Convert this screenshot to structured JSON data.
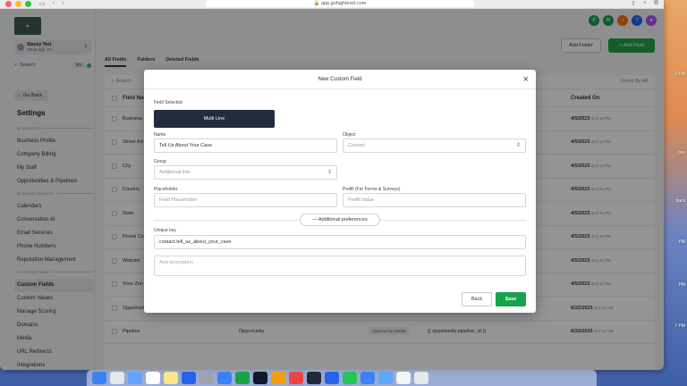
{
  "browser": {
    "url": "app.gohighlevel.com"
  },
  "sidebar": {
    "logo_text": "",
    "account_name": "Stacey Test",
    "account_location": "Pittsburgh, PA",
    "search_label": "Search",
    "search_shortcut": "⌘K",
    "go_back": "Go Back",
    "settings_title": "Settings",
    "sections": [
      {
        "title": "MY BUSINESS",
        "items": [
          "Business Profile",
          "Company Billing",
          "My Staff",
          "Opportunities & Pipelines"
        ]
      },
      {
        "title": "BUSINESS SERVICES",
        "items": [
          "Calendars",
          "Conversation AI",
          "Email Services",
          "Phone Numbers",
          "Reputation Management"
        ]
      },
      {
        "title": "OTHER SETTINGS",
        "items": [
          "Custom Fields",
          "Custom Values",
          "Manage Scoring",
          "Domains",
          "Media",
          "URL Redirects",
          "Integrations"
        ]
      }
    ],
    "active_item": "Custom Fields"
  },
  "main": {
    "tabs": [
      "All Fields",
      "Folders",
      "Deleted Fields"
    ],
    "add_folder": "Add Folder",
    "add_field": "+ Add Field",
    "search_placeholder": "Search",
    "group_by": "Group By All",
    "columns": {
      "name": "Field Name",
      "created": "Created On"
    },
    "rows": [
      {
        "name": "Business",
        "object": "",
        "folder": "",
        "key": "",
        "date": "4/5/2023",
        "time": "at 4:16 PM"
      },
      {
        "name": "Street Ad",
        "object": "",
        "folder": "",
        "key": "",
        "date": "4/5/2023",
        "time": "at 4:16 PM"
      },
      {
        "name": "City",
        "object": "",
        "folder": "",
        "key": "",
        "date": "4/5/2023",
        "time": "at 4:16 PM"
      },
      {
        "name": "Country",
        "object": "",
        "folder": "",
        "key": "",
        "date": "4/5/2023",
        "time": "at 4:16 PM"
      },
      {
        "name": "State",
        "object": "",
        "folder": "",
        "key": "",
        "date": "4/5/2023",
        "time": "at 4:16 PM"
      },
      {
        "name": "Postal Co",
        "object": "",
        "folder": "",
        "key": "",
        "date": "4/5/2023",
        "time": "at 4:16 PM"
      },
      {
        "name": "Website",
        "object": "",
        "folder": "",
        "key": "",
        "date": "4/5/2023",
        "time": "at 4:16 PM"
      },
      {
        "name": "Time Zon",
        "object": "",
        "folder": "",
        "key": "",
        "date": "4/5/2023",
        "time": "at 4:16 PM"
      },
      {
        "name": "Opportunity Name",
        "object": "Opportunity",
        "folder": "Opportunity Details",
        "key": "{{ opportunity.name }}",
        "date": "6/22/2023",
        "time": "at 4:14 AM"
      },
      {
        "name": "Pipeline",
        "object": "Opportunity",
        "folder": "Opportunity Details",
        "key": "{{ opportunity.pipeline_id }}",
        "date": "6/22/2023",
        "time": "at 4:14 AM"
      }
    ]
  },
  "modal": {
    "title": "New Custom Field",
    "field_selected_label": "Field Selected",
    "field_type": "Multi Line",
    "name_label": "Name",
    "name_value": "Tell Us About Your Case",
    "object_label": "Object",
    "object_value": "Contact",
    "group_label": "Group",
    "group_value": "Additional Info",
    "placeholder_label": "Placeholder",
    "placeholder_value": "Field Placeholder",
    "prefill_label": "Prefill (For Forms & Surveys)",
    "prefill_value": "Prefill Value",
    "advanced": "— Additional preferences",
    "unique_key_label": "Unique key",
    "unique_key_value": "contact.tell_us_about_your_case",
    "description_placeholder": "Add description",
    "back": "Back",
    "save": "Save"
  },
  "desktop_labels": [
    "3 PM",
    "tice",
    "back",
    "PM",
    "PM",
    "7 PM"
  ],
  "colors": {
    "accent_green": "#16a34a",
    "field_type_bg": "#1f2d3d"
  }
}
